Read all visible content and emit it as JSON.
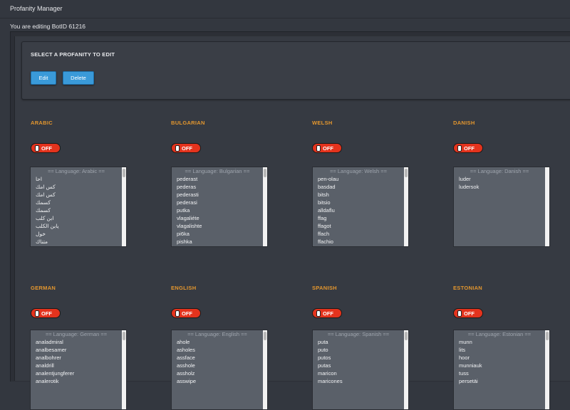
{
  "app": {
    "title": "Profanity Manager",
    "editing_label": "You are editing BotID 61216"
  },
  "selector": {
    "title": "SELECT A PROFANITY TO EDIT",
    "edit_label": "Edit",
    "delete_label": "Delete"
  },
  "languages": [
    {
      "name": "ARABIC",
      "toggle": "OFF",
      "header": "== Language: Arabic ==",
      "words": [
        "احا",
        "كس امك",
        "كس امك",
        "كسمك",
        "كسمك",
        "ابن كلب",
        "يابن الكلب",
        "خول",
        "متناك"
      ]
    },
    {
      "name": "BULGARIAN",
      "toggle": "OFF",
      "header": "== Language: Bulgarian ==",
      "words": [
        "pederast",
        "pederas",
        "pederasti",
        "pederasi",
        "putka",
        "vlagaliéte",
        "vlagalishte",
        "pi6ka",
        "pishka"
      ]
    },
    {
      "name": "WELSH",
      "toggle": "OFF",
      "header": "== Language: Welsh ==",
      "words": [
        "pen-olau",
        "basdad",
        "bitsh",
        "bitsio",
        "alldaflu",
        "ffag",
        "ffagot",
        "ffach",
        "ffachio"
      ]
    },
    {
      "name": "DANISH",
      "toggle": "OFF",
      "header": "== Language: Danish ==",
      "words": [
        "luder",
        "ludersok"
      ]
    },
    {
      "name": "GERMAN",
      "toggle": "OFF",
      "header": "== Language: German ==",
      "words": [
        "analadmiral",
        "analbesamer",
        "analbohrer",
        "analdrill",
        "analentjungferer",
        "analerotik"
      ]
    },
    {
      "name": "ENGLISH",
      "toggle": "OFF",
      "header": "== Language: English ==",
      "words": [
        "ahole",
        "asholes",
        "assface",
        "asshole",
        "assholz",
        "asswipe"
      ]
    },
    {
      "name": "SPANISH",
      "toggle": "OFF",
      "header": "== Language: Spanish ==",
      "words": [
        "puta",
        "puto",
        "putos",
        "putas",
        "maricon",
        "maricones"
      ]
    },
    {
      "name": "ESTONIAN",
      "toggle": "OFF",
      "header": "== Language: Estonian ==",
      "words": [
        "munn",
        "lits",
        "hoor",
        "munniauk",
        "tuss",
        "persetäi"
      ]
    }
  ]
}
